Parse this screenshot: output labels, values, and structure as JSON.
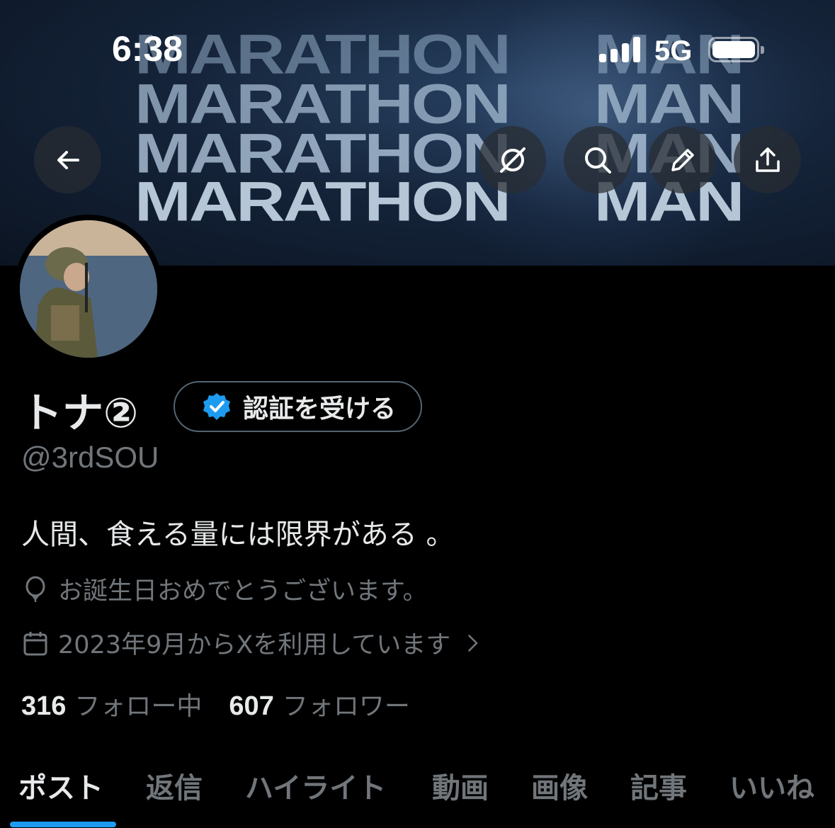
{
  "status_bar": {
    "time": "6:38",
    "network": "5G",
    "signal_bars": 4,
    "battery_level": 1.0
  },
  "banner": {
    "rows": [
      {
        "left": "MARATHON",
        "right": "MAN"
      },
      {
        "left": "MARATHON",
        "right": "MAN"
      },
      {
        "left": "MARATHON",
        "right": "MAN"
      },
      {
        "left": "MARATHON",
        "right": "MAN"
      }
    ]
  },
  "nav": {
    "back_icon": "arrow-left-icon",
    "actions": [
      "grok-icon",
      "search-icon",
      "pencil-icon",
      "share-icon"
    ]
  },
  "profile": {
    "display_name": "トナ②",
    "verify_button_label": "認証を受ける",
    "handle": "@3rdSOU",
    "bio": "人間、食える量には限界がある 。",
    "birthday": "お誕生日おめでとうございます。",
    "joined": "2023年9月からXを利用しています",
    "following_count": "316",
    "following_label": "フォロー中",
    "followers_count": "607",
    "followers_label": "フォロワー"
  },
  "tabs": [
    {
      "label": "ポスト",
      "active": true
    },
    {
      "label": "返信",
      "active": false
    },
    {
      "label": "ハイライト",
      "active": false
    },
    {
      "label": "動画",
      "active": false
    },
    {
      "label": "画像",
      "active": false
    },
    {
      "label": "記事",
      "active": false
    },
    {
      "label": "いいね",
      "active": false
    }
  ],
  "colors": {
    "accent": "#1d9bf0",
    "background": "#000000",
    "text_primary": "#e7e9ea",
    "text_secondary": "#71767b"
  }
}
